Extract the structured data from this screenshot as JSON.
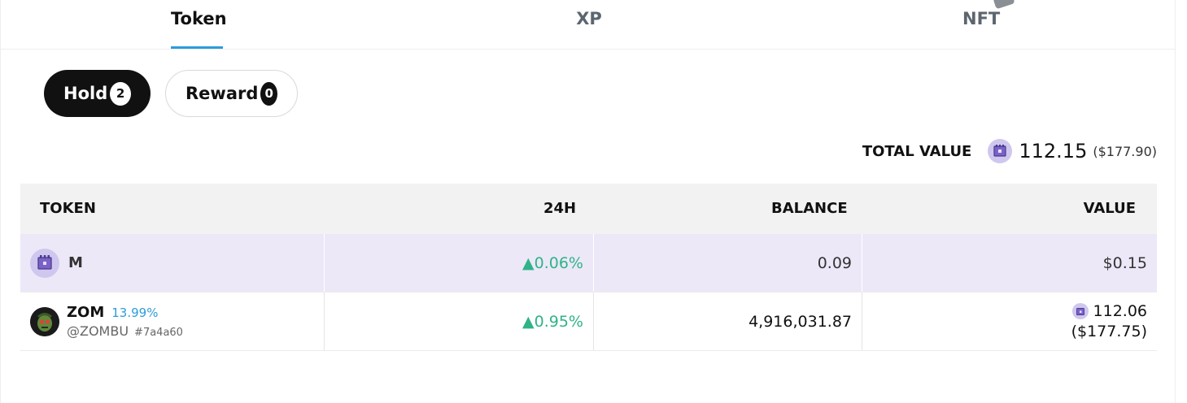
{
  "tabs": [
    {
      "label": "Token",
      "active": true
    },
    {
      "label": "XP",
      "active": false
    },
    {
      "label": "NFT",
      "active": false
    }
  ],
  "filters": {
    "hold": {
      "label": "Hold",
      "count": "2",
      "active": true
    },
    "reward": {
      "label": "Reward",
      "count": "0",
      "active": false
    }
  },
  "total": {
    "label": "TOTAL VALUE",
    "amount": "112.15",
    "usd": "($177.90)",
    "icon": "token-coin-icon"
  },
  "table": {
    "headers": [
      "TOKEN",
      "24H",
      "BALANCE",
      "VALUE"
    ],
    "rows": [
      {
        "symbol": "M",
        "change": "▲0.06%",
        "balance": "0.09",
        "value": "$0.15",
        "icon": "token-coin-icon",
        "highlighted": true
      },
      {
        "symbol": "ZOM",
        "percent": "13.99%",
        "handle": "@ZOMBU",
        "hash": "#7a4a60",
        "change": "▲0.95%",
        "balance": "4,916,031.87",
        "value_amount": "112.06",
        "value_usd": "($177.75)",
        "icon": "zombie-avatar-icon",
        "highlighted": false
      }
    ]
  },
  "colors": {
    "accent": "#2d9cdb",
    "positive": "#2fb388",
    "highlight_row": "#ece8f8",
    "coin": "#cfc7ee"
  }
}
